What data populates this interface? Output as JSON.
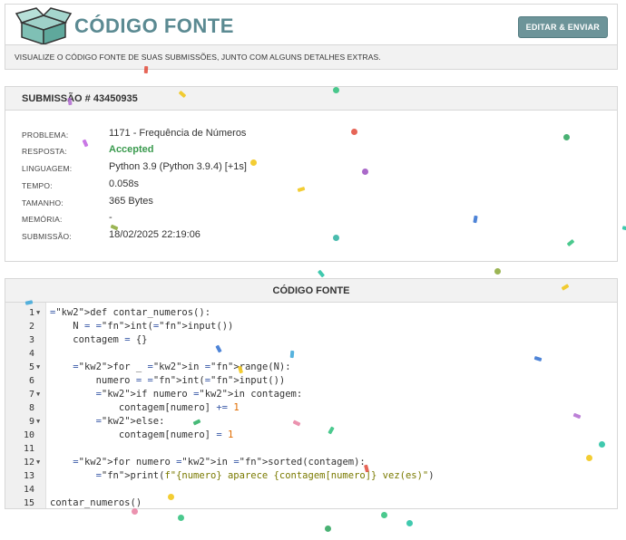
{
  "header": {
    "title": "CÓDIGO FONTE",
    "edit_button": "EDITAR & ENVIAR",
    "subtitle": "VISUALIZE O CÓDIGO FONTE DE SUAS SUBMISSÕES, JUNTO COM ALGUNS DETALHES EXTRAS."
  },
  "submission": {
    "title": "SUBMISSÃO # 43450935",
    "rows": [
      {
        "label": "PROBLEMA:",
        "value": "1171 - Frequência de Números"
      },
      {
        "label": "RESPOSTA:",
        "value": "Accepted"
      },
      {
        "label": "LINGUAGEM:",
        "value": "Python 3.9 (Python 3.9.4) [+1s]"
      },
      {
        "label": "TEMPO:",
        "value": "0.058s"
      },
      {
        "label": "TAMANHO:",
        "value": "365 Bytes"
      },
      {
        "label": "MEMÓRIA:",
        "value": "-"
      },
      {
        "label": "SUBMISSÃO:",
        "value": "18/02/2025 22:19:06"
      }
    ]
  },
  "code": {
    "title": "CÓDIGO FONTE",
    "lines": [
      "def contar_numeros():",
      "    N = int(input())",
      "    contagem = {}",
      "",
      "    for _ in range(N):",
      "        numero = int(input())",
      "        if numero in contagem:",
      "            contagem[numero] += 1",
      "        else:",
      "            contagem[numero] = 1",
      "",
      "    for numero in sorted(contagem):",
      "        print(f\"{numero} aparece {contagem[numero]} vez(es)\")",
      "",
      "contar_numeros()"
    ],
    "line_numbers": [
      "1",
      "2",
      "3",
      "4",
      "5",
      "6",
      "7",
      "8",
      "9",
      "10",
      "11",
      "12",
      "13",
      "14",
      "15"
    ],
    "fold_lines": [
      1,
      5,
      7,
      9,
      12
    ]
  },
  "colors": {
    "brand": "#5b8a92",
    "accepted": "#3a9a4e",
    "button": "#6d9499"
  }
}
